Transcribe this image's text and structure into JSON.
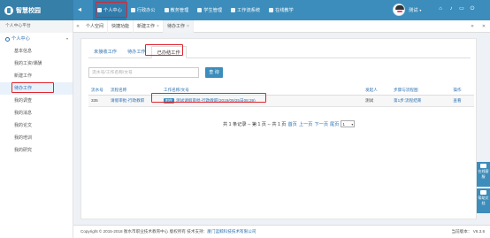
{
  "app": {
    "logo_text": "智慧校园",
    "logo_icon": "school-logo-icon"
  },
  "topbar": {
    "back_icon": "arrow-left-icon",
    "nav": [
      {
        "label": "个人中心",
        "icon": "user-icon",
        "active": true
      },
      {
        "label": "行政办公",
        "icon": "briefcase-icon"
      },
      {
        "label": "教务管理",
        "icon": "book-icon"
      },
      {
        "label": "学生管理",
        "icon": "users-icon"
      },
      {
        "label": "工作流系统",
        "icon": "flow-icon"
      },
      {
        "label": "在线教学",
        "icon": "monitor-icon"
      }
    ],
    "user": {
      "name": "测试",
      "caret": "▾"
    },
    "icons": [
      "home-icon",
      "bell-icon",
      "screen-icon",
      "power-icon"
    ]
  },
  "tabstrip": {
    "sidebar_title": "个人中心平台",
    "prev": "«",
    "next": "»",
    "close": "✕",
    "tabs": [
      {
        "label": "个人空间"
      },
      {
        "label": "快捷功能"
      },
      {
        "label": "新建工作",
        "closable": "×"
      },
      {
        "label": "待办工作",
        "closable": "×",
        "active": true
      }
    ]
  },
  "sidebar": {
    "group": {
      "label": "个人中心",
      "arrow": "▾"
    },
    "items": [
      {
        "label": "基本信息"
      },
      {
        "label": "我的工资/课酬"
      },
      {
        "label": "新建工作"
      },
      {
        "label": "待办工作",
        "active": true
      },
      {
        "label": "我的调查"
      },
      {
        "label": "我的消息"
      },
      {
        "label": "我的论文"
      },
      {
        "label": "我的培训"
      },
      {
        "label": "我的研究"
      }
    ]
  },
  "main": {
    "subtabs": [
      {
        "label": "未接收工作"
      },
      {
        "label": "待办工作"
      },
      {
        "label": "已办结工作",
        "active": true
      }
    ],
    "search": {
      "placeholder": "流水号/工作名称/文号",
      "button": "查 询"
    },
    "table": {
      "headers": [
        "流水号",
        "流程名称",
        "工作名称/文号",
        "发起人",
        "步骤与流程图",
        "操作"
      ],
      "rows": [
        {
          "serial": "335",
          "flow": "请假审批-行政教职",
          "badge": "附件",
          "work": "测试请假审批-行政教职(2019/09/25日08:39)",
          "initiator": "测试",
          "step": "第1步:流程结束",
          "action": "查看"
        }
      ]
    },
    "pager": {
      "prefix": "共 1 条记录 -- 第 1 页 -- 共 1 页",
      "first": "首页",
      "prev": "上一页",
      "next": "下一页",
      "last": "尾页",
      "page": "1"
    }
  },
  "float": [
    {
      "label": "在线客服"
    },
    {
      "label": "帮助文档"
    }
  ],
  "footer": {
    "copyright": "Copyright © 2015-2018  衡水市职业技术教育中心 版权所有  技术支持：",
    "company": "厦门蓝鲸科技技术有限公司",
    "version": "当前版本：  V6.3.8"
  }
}
